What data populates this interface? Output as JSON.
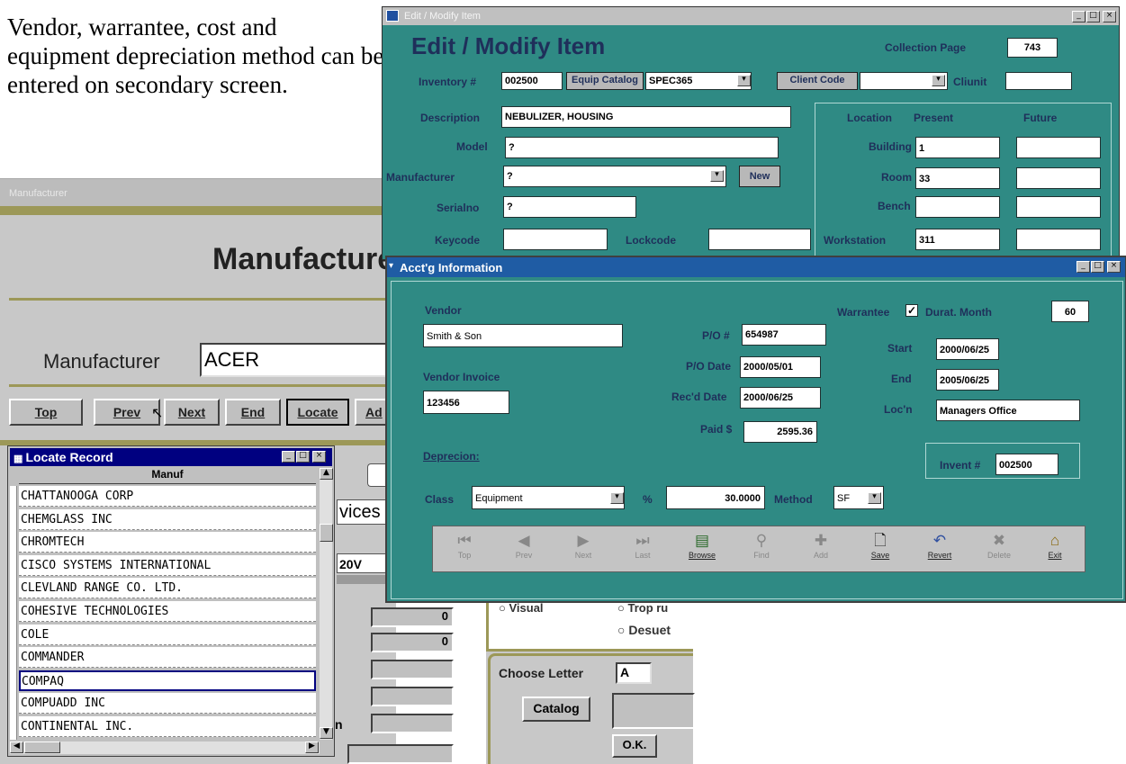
{
  "caption": "Vendor, warrantee, cost and equipment depreciation method can be entered on secondary screen.",
  "manufacturer_window": {
    "title": "Manufacturer",
    "heading": "Manufacturer",
    "field_label": "Manufacturer",
    "field_value": "ACER",
    "nav_buttons": [
      "Top",
      "Prev",
      "Next",
      "End",
      "Locate",
      "Ad"
    ],
    "partial_texts": [
      "vices",
      "20V"
    ],
    "side_values": [
      "0",
      "0"
    ],
    "partial_label": "n"
  },
  "locate_record": {
    "title": "Locate Record",
    "column_header": "Manuf",
    "rows": [
      "CHATTANOOGA CORP",
      "CHEMGLASS INC",
      "CHROMTECH",
      "CISCO SYSTEMS INTERNATIONAL",
      "CLEVLAND RANGE CO. LTD.",
      "COHESIVE TECHNOLOGIES",
      "COLE",
      "COMMANDER",
      "COMPAQ",
      "COMPUADD INC",
      "CONTINENTAL INC."
    ],
    "selected": "COMPAQ"
  },
  "edit_window": {
    "title": "Edit / Modify Item",
    "heading": "Edit / Modify Item",
    "collection_page_label": "Collection Page",
    "collection_page": "743",
    "inventory_label": "Inventory #",
    "inventory": "002500",
    "equip_catalog_button": "Equip Catalog",
    "equip_catalog": "SPEC365",
    "client_code_button": "Client Code",
    "client_code": "",
    "cliunit_label": "Cliunit",
    "cliunit": "",
    "description_label": "Description",
    "description": "NEBULIZER, HOUSING",
    "model_label": "Model",
    "model": "?",
    "manufacturer_label": "Manufacturer",
    "manufacturer": "?",
    "new_button": "New",
    "serialno_label": "Serialno",
    "serialno": "?",
    "keycode_label": "Keycode",
    "keycode": "",
    "lockcode_label": "Lockcode",
    "lockcode": "",
    "location_header": "Location",
    "present_header": "Present",
    "future_header": "Future",
    "building_label": "Building",
    "building": "1",
    "room_label": "Room",
    "room": "33",
    "bench_label": "Bench",
    "bench": "",
    "workstation_label": "Workstation",
    "workstation": "311"
  },
  "acct_window": {
    "title": "Acct'g Information",
    "vendor_label": "Vendor",
    "vendor": "Smith & Son",
    "vendor_invoice_label": "Vendor Invoice",
    "vendor_invoice": "123456",
    "po_label": "P/O #",
    "po": "654987",
    "po_date_label": "P/O Date",
    "po_date": "2000/05/01",
    "recd_date_label": "Rec'd Date",
    "recd_date": "2000/06/25",
    "paid_label": "Paid $",
    "paid": "2595.36",
    "warrantee_label": "Warrantee",
    "durat_label": "Durat. Month",
    "durat": "60",
    "start_label": "Start",
    "start": "2000/06/25",
    "end_label": "End",
    "end": "2005/06/25",
    "locn_label": "Loc'n",
    "locn": "Managers Office",
    "invent_label": "Invent #",
    "invent": "002500",
    "deprecion_label": "Deprecion:",
    "class_label": "Class",
    "class": "Equipment",
    "pct_label": "%",
    "pct": "30.0000",
    "method_label": "Method",
    "method": "SF",
    "toolbar": [
      "Top",
      "Prev",
      "Next",
      "Last",
      "Browse",
      "Find",
      "Add",
      "Save",
      "Revert",
      "Delete",
      "Exit"
    ]
  },
  "bottom_panel": {
    "option_a": "Visual",
    "option_b": "Trop ru",
    "option_c": "Desuet",
    "choose_letter_label": "Choose Letter",
    "choose_letter": "A",
    "catalog_button": "Catalog",
    "ok_button": "O.K."
  }
}
